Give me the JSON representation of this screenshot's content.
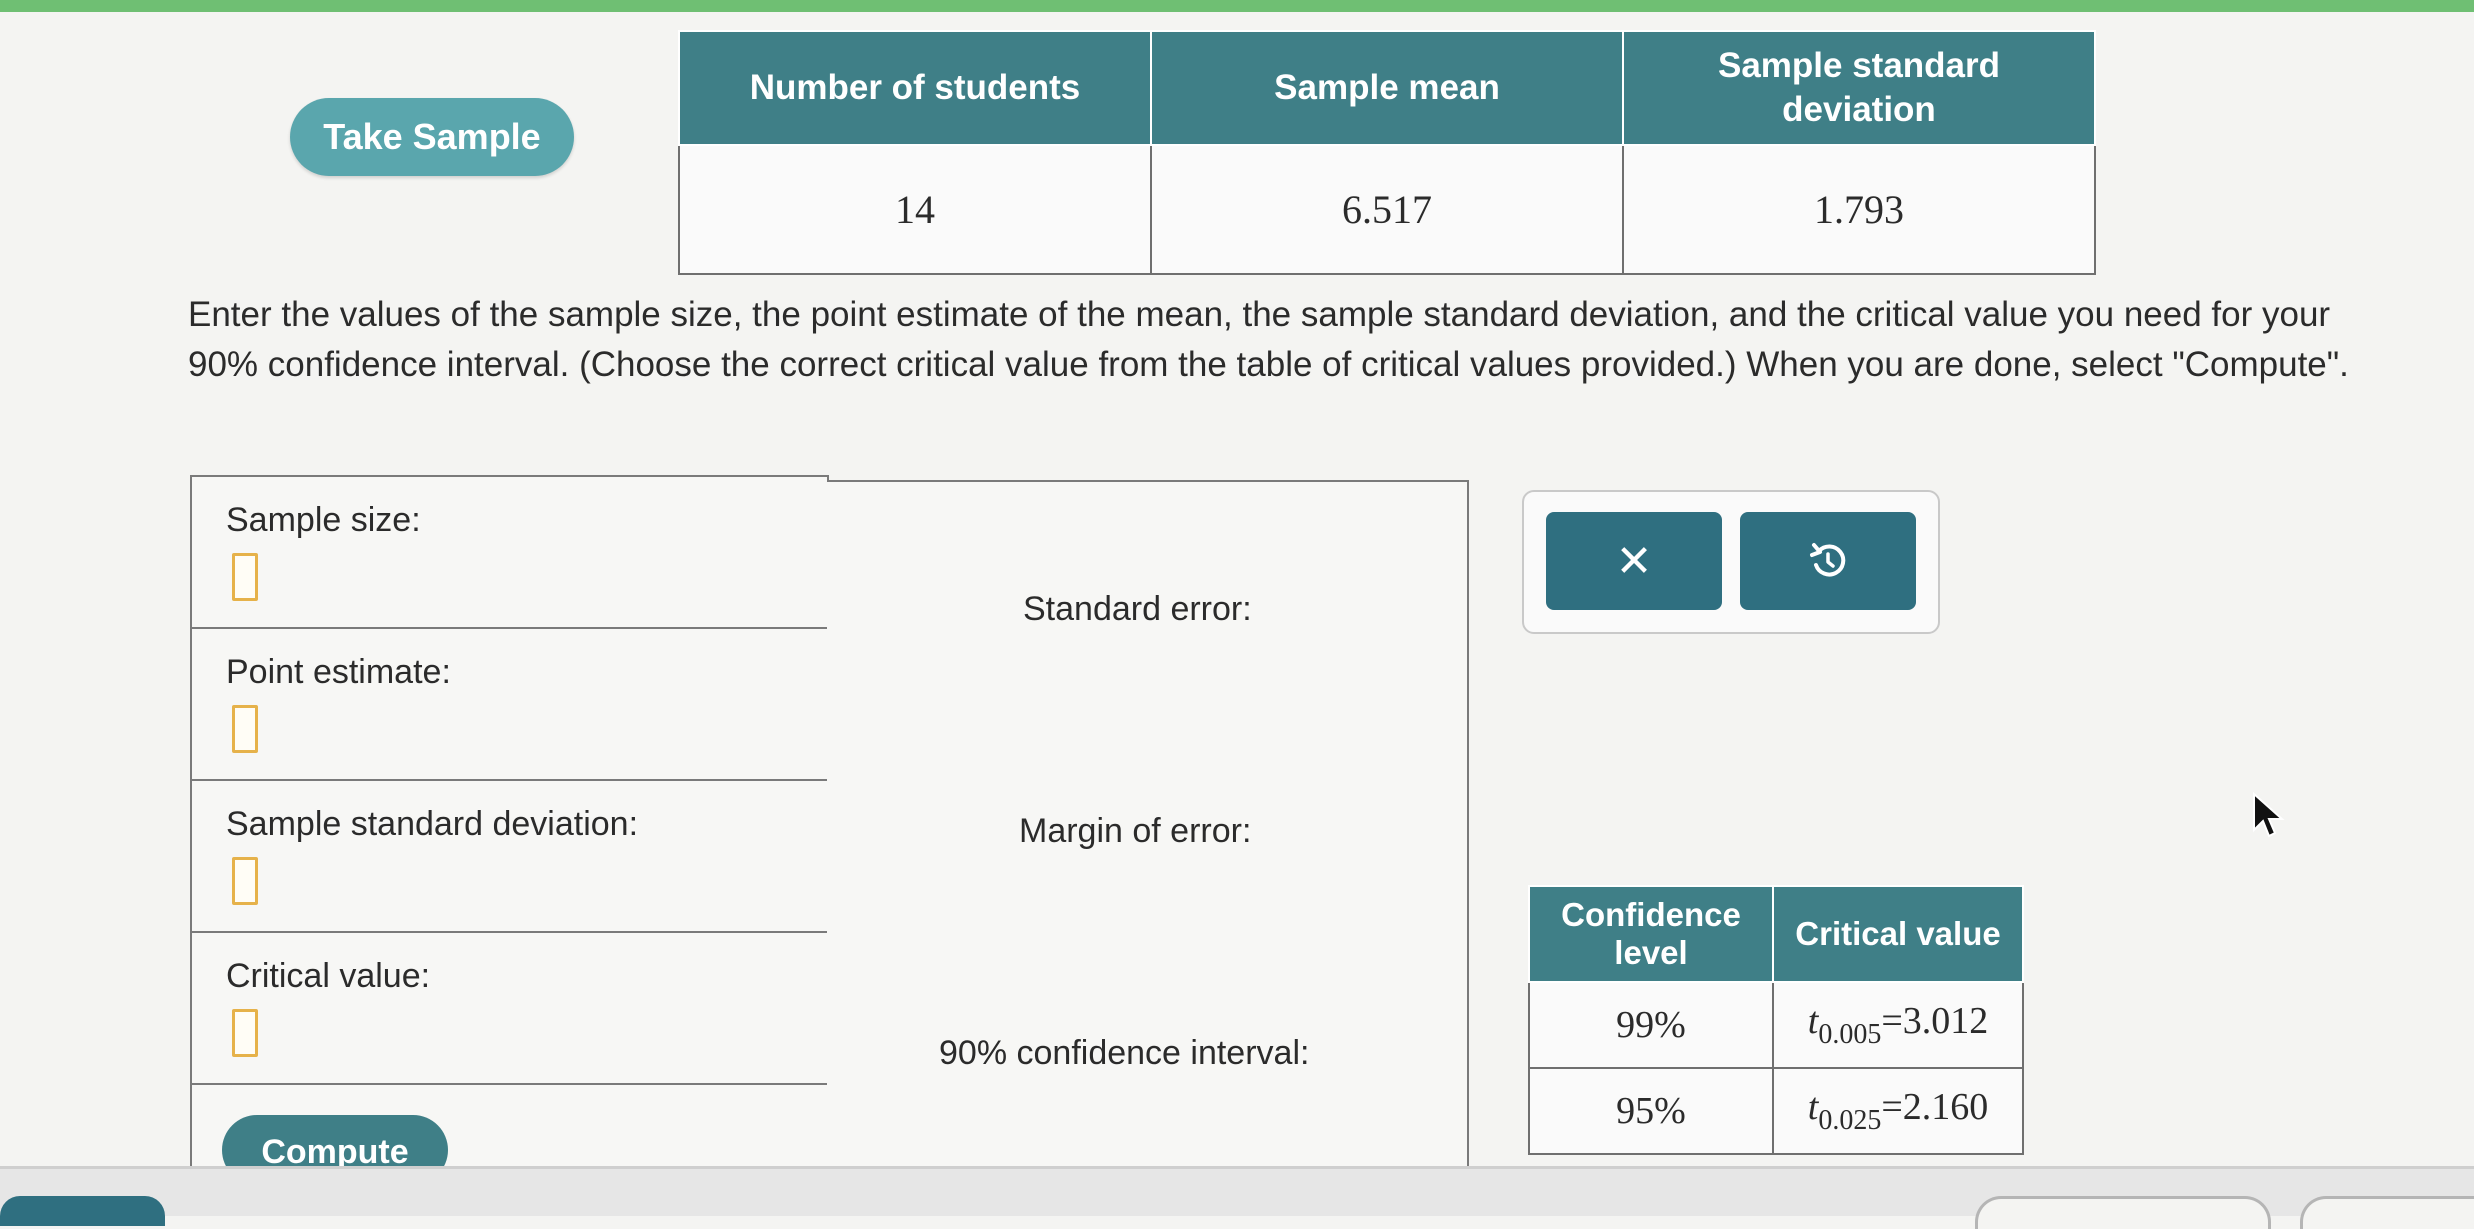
{
  "take_sample_label": "Take Sample",
  "sample_table": {
    "headers": [
      "Number of students",
      "Sample mean",
      "Sample standard deviation"
    ],
    "values": [
      "14",
      "6.517",
      "1.793"
    ]
  },
  "instructions": "Enter the values of the sample size, the point estimate of the mean, the sample standard deviation, and the critical value you need for your 90% confidence interval. (Choose the correct critical value from the table of critical values provided.) When you are done, select \"Compute\".",
  "inputs": {
    "sample_size_label": "Sample size:",
    "point_estimate_label": "Point estimate:",
    "sample_sd_label": "Sample standard deviation:",
    "critical_value_label": "Critical value:",
    "compute_label": "Compute"
  },
  "results": {
    "standard_error_label": "Standard error:",
    "margin_of_error_label": "Margin of error:",
    "ci_label": "90% confidence interval:"
  },
  "actions": {
    "clear_icon": "close-icon",
    "reset_icon": "undo-icon",
    "clear_glyph": "✕"
  },
  "critical_table": {
    "headers": [
      "Confidence level",
      "Critical value"
    ],
    "rows": [
      {
        "level": "99%",
        "t_sub": "0.005",
        "value": "=3.012"
      },
      {
        "level": "95%",
        "t_sub": "0.025",
        "value": "=2.160"
      }
    ],
    "t_symbol": "t"
  },
  "colors": {
    "header_teal": "#3f7f87",
    "button_teal": "#5aa6ad",
    "input_outline": "#e6b24a",
    "action_button": "#2f6f80"
  }
}
